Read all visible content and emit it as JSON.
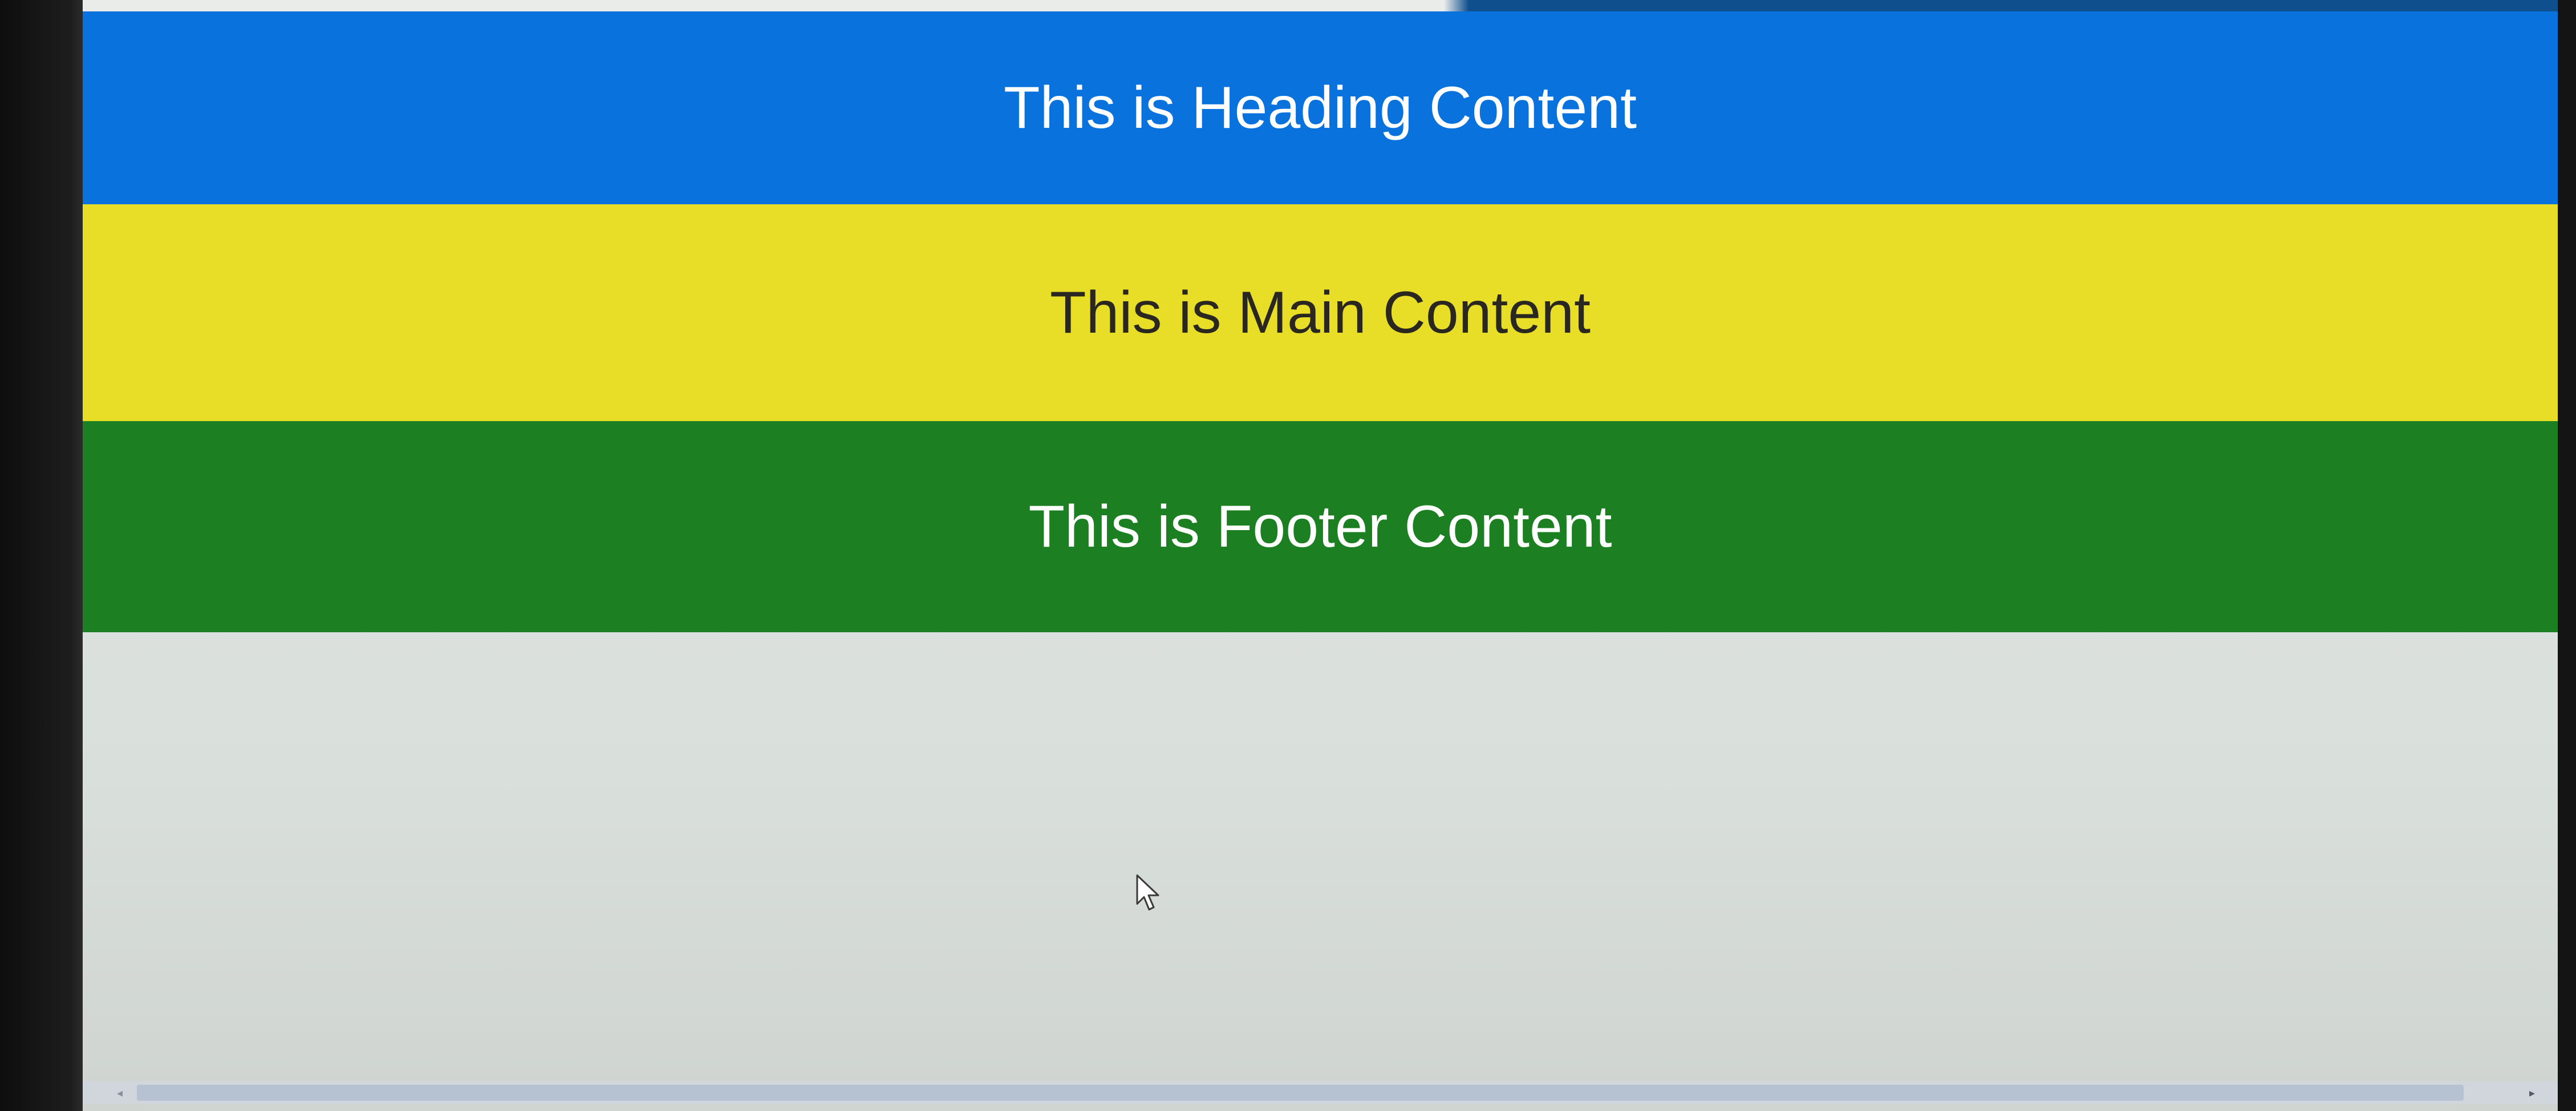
{
  "page": {
    "heading_text": "This is Heading Content",
    "main_text": "This is Main Content",
    "footer_text": "This is Footer Content"
  },
  "colors": {
    "heading_bg": "#0a72dd",
    "main_bg": "#e8dd27",
    "footer_bg": "#1c7f21",
    "page_bg": "#e3e8e4"
  },
  "icons": {
    "cursor": "mouse-pointer-icon",
    "scroll_left": "scroll-left-arrow-icon",
    "scroll_right": "scroll-right-arrow-icon"
  }
}
